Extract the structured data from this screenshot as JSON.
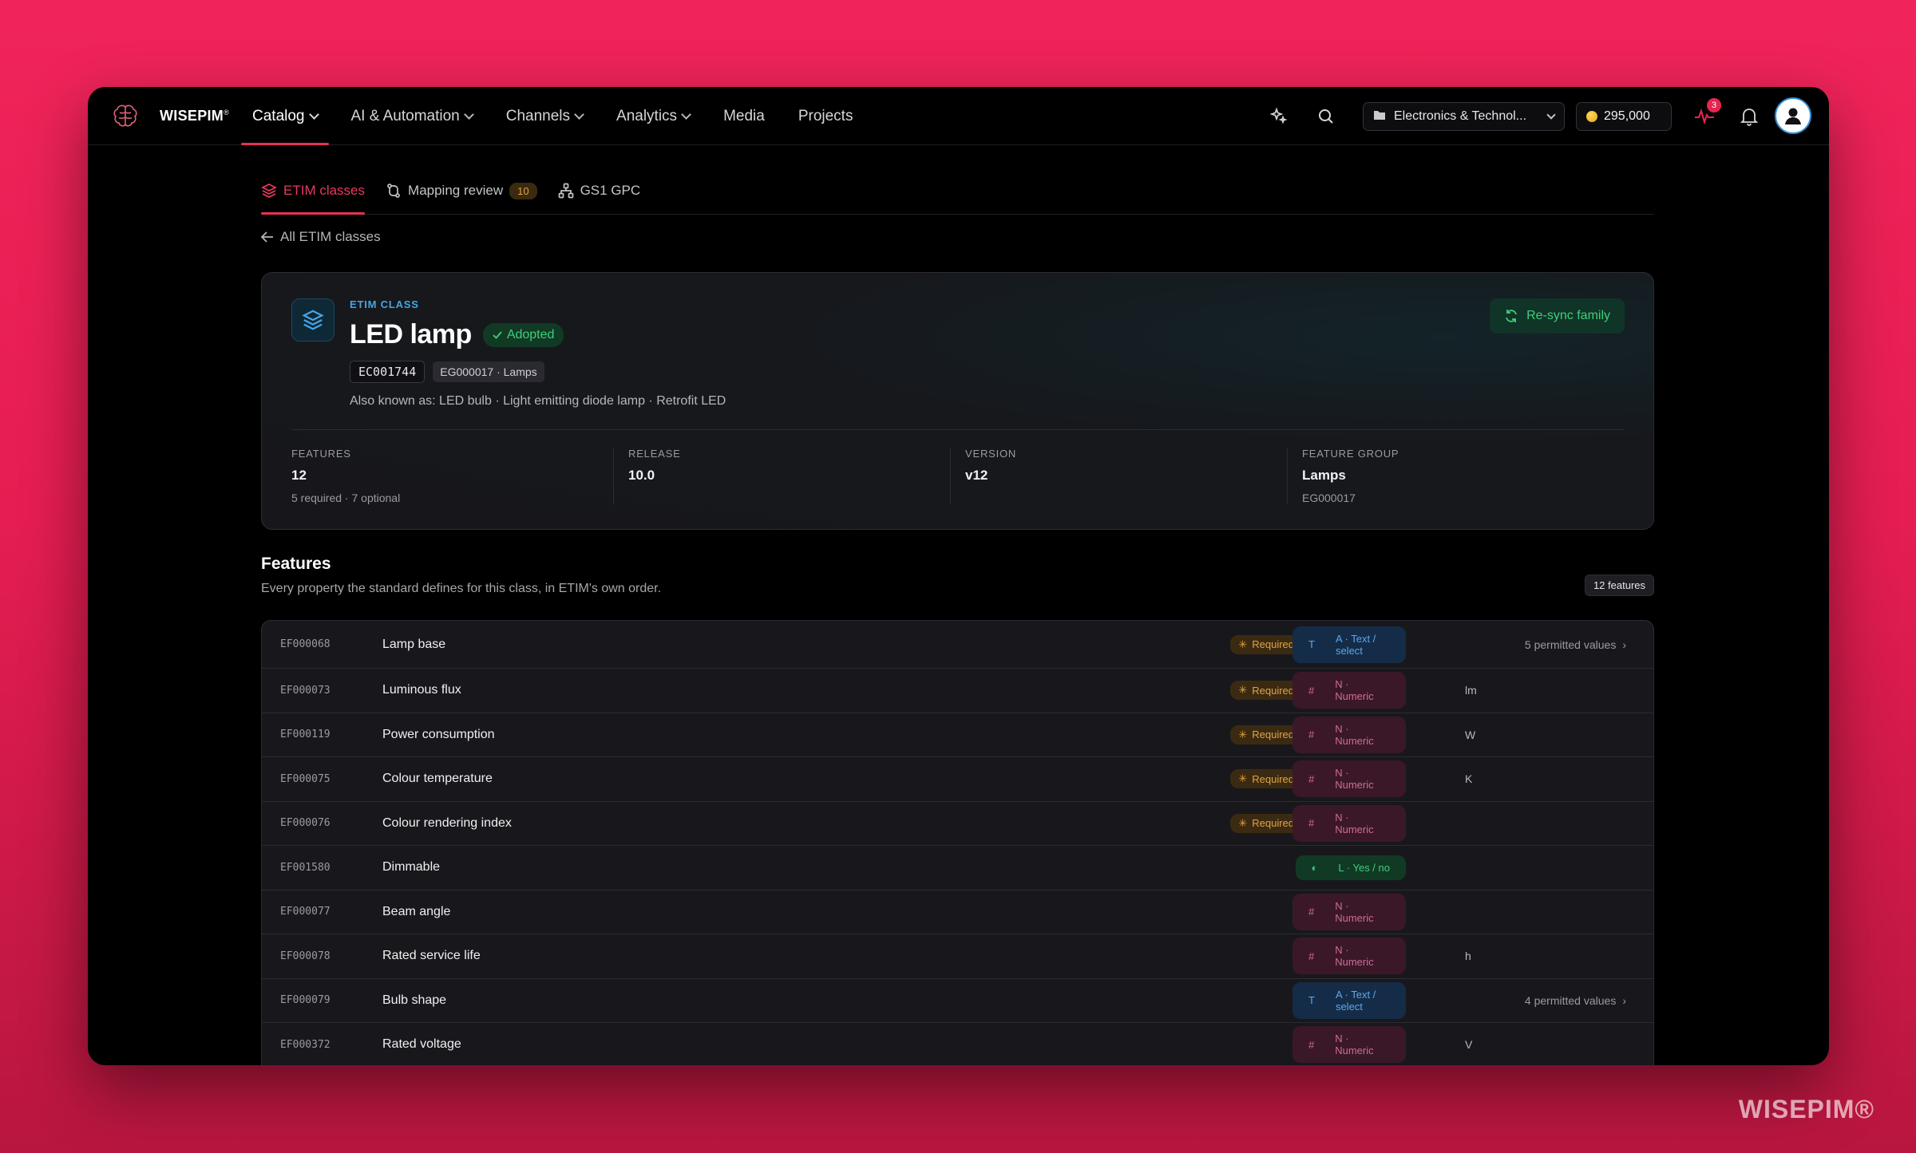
{
  "brand": {
    "name": "WISEPIM",
    "mark": "®"
  },
  "nav": {
    "items": [
      {
        "label": "Catalog",
        "dropdown": true,
        "active": true
      },
      {
        "label": "AI & Automation",
        "dropdown": true
      },
      {
        "label": "Channels",
        "dropdown": true
      },
      {
        "label": "Analytics",
        "dropdown": true
      },
      {
        "label": "Media",
        "dropdown": false
      },
      {
        "label": "Projects",
        "dropdown": false
      }
    ]
  },
  "header": {
    "workspace": "Electronics & Technol...",
    "credits": "295,000",
    "activity_badge": "3"
  },
  "subtabs": [
    {
      "label": "ETIM classes",
      "active": true
    },
    {
      "label": "Mapping review",
      "count": "10"
    },
    {
      "label": "GS1 GPC"
    }
  ],
  "back_link": "All ETIM classes",
  "class": {
    "eyebrow": "ETIM CLASS",
    "title": "LED lamp",
    "status": "Adopted",
    "code": "EC001744",
    "group_code": "EG000017 · Lamps",
    "aka": "Also known as: LED bulb · Light emitting diode lamp · Retrofit LED",
    "resync_label": "Re-sync family"
  },
  "stats": [
    {
      "label": "FEATURES",
      "value": "12",
      "sub": "5 required · 7 optional"
    },
    {
      "label": "RELEASE",
      "value": "10.0",
      "sub": ""
    },
    {
      "label": "VERSION",
      "value": "v12",
      "sub": ""
    },
    {
      "label": "FEATURE GROUP",
      "value": "Lamps",
      "sub": "EG000017"
    }
  ],
  "features": {
    "title": "Features",
    "description": "Every property the standard defines for this class, in ETIM's own order.",
    "count": "12 features",
    "rows": [
      {
        "code": "EF000068",
        "name": "Lamp base",
        "required": "Required",
        "type": "A · Text / select",
        "type_key": "A",
        "unit": "",
        "permitted": "5 permitted values"
      },
      {
        "code": "EF000073",
        "name": "Luminous flux",
        "required": "Required",
        "type": "N · Numeric",
        "type_key": "N",
        "unit": "lm",
        "permitted": ""
      },
      {
        "code": "EF000119",
        "name": "Power consumption",
        "required": "Required",
        "type": "N · Numeric",
        "type_key": "N",
        "unit": "W",
        "permitted": ""
      },
      {
        "code": "EF000075",
        "name": "Colour temperature",
        "required": "Required",
        "type": "N · Numeric",
        "type_key": "N",
        "unit": "K",
        "permitted": ""
      },
      {
        "code": "EF000076",
        "name": "Colour rendering index",
        "required": "Required",
        "type": "N · Numeric",
        "type_key": "N",
        "unit": "",
        "permitted": ""
      },
      {
        "code": "EF001580",
        "name": "Dimmable",
        "required": "",
        "type": "L · Yes / no",
        "type_key": "L",
        "unit": "",
        "permitted": ""
      },
      {
        "code": "EF000077",
        "name": "Beam angle",
        "required": "",
        "type": "N · Numeric",
        "type_key": "N",
        "unit": "",
        "permitted": ""
      },
      {
        "code": "EF000078",
        "name": "Rated service life",
        "required": "",
        "type": "N · Numeric",
        "type_key": "N",
        "unit": "h",
        "permitted": ""
      },
      {
        "code": "EF000079",
        "name": "Bulb shape",
        "required": "",
        "type": "A · Text / select",
        "type_key": "A",
        "unit": "",
        "permitted": "4 permitted values"
      },
      {
        "code": "EF000372",
        "name": "Rated voltage",
        "required": "",
        "type": "N · Numeric",
        "type_key": "N",
        "unit": "V",
        "permitted": ""
      }
    ]
  },
  "watermark": "WISEPIM®",
  "colors": {
    "accent": "#e53255",
    "info": "#45a6e6",
    "success": "#3fcf7a",
    "warning": "#e2a344"
  }
}
